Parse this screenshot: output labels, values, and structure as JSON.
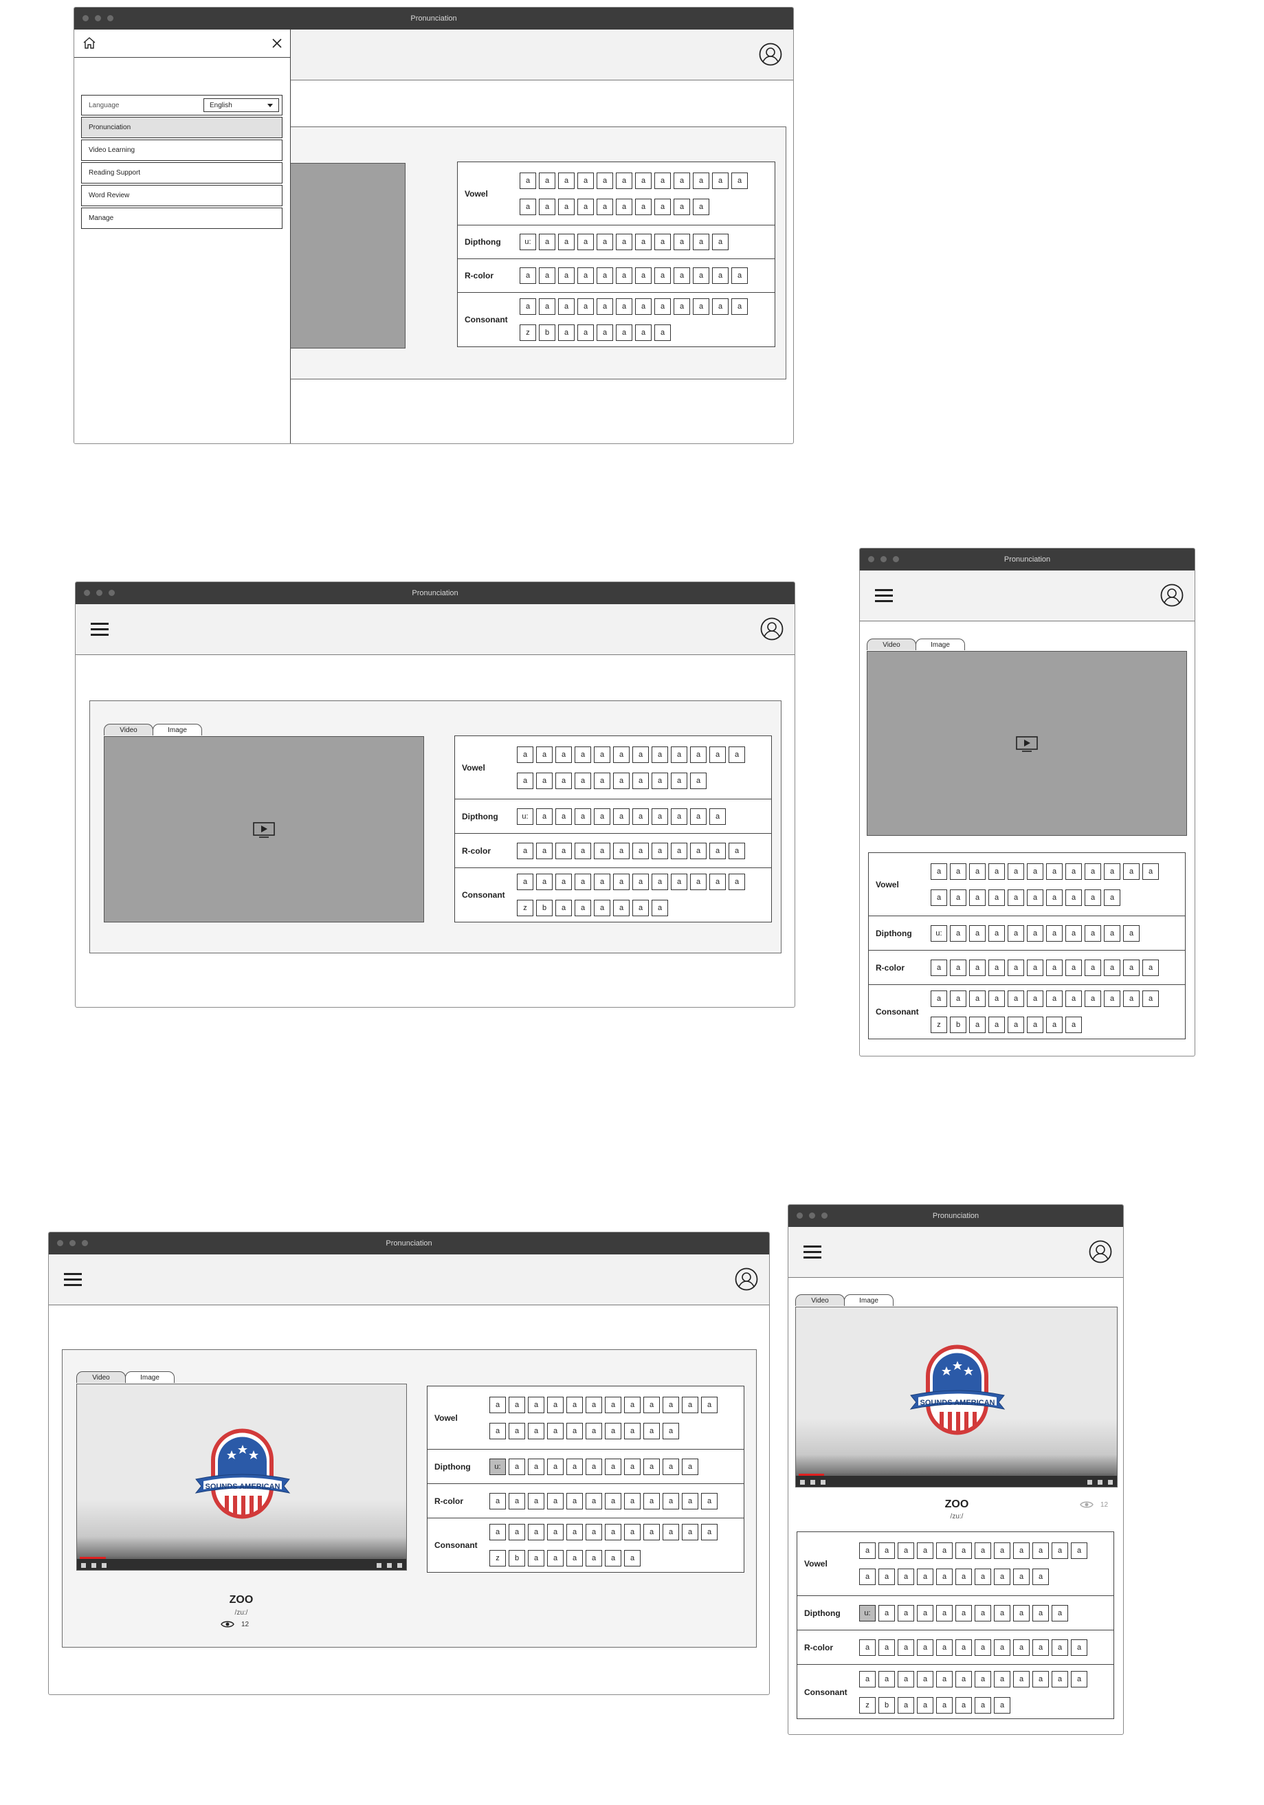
{
  "window_title": "Pronunciation",
  "tabs": [
    "Video",
    "Image"
  ],
  "drawer": {
    "language_label": "Language",
    "language_value": "English",
    "menu": [
      "Pronunciation",
      "Video Learning",
      "Reading Support",
      "Word Review",
      "Manage"
    ]
  },
  "sound_table": {
    "rows": [
      {
        "label": "Vowel",
        "lines": [
          [
            "a",
            "a",
            "a",
            "a",
            "a",
            "a",
            "a",
            "a",
            "a",
            "a",
            "a",
            "a"
          ],
          [
            "a",
            "a",
            "a",
            "a",
            "a",
            "a",
            "a",
            "a",
            "a",
            "a"
          ]
        ]
      },
      {
        "label": "Dipthong",
        "lines": [
          [
            "u:",
            "a",
            "a",
            "a",
            "a",
            "a",
            "a",
            "a",
            "a",
            "a",
            "a"
          ]
        ]
      },
      {
        "label": "R-color",
        "lines": [
          [
            "a",
            "a",
            "a",
            "a",
            "a",
            "a",
            "a",
            "a",
            "a",
            "a",
            "a",
            "a"
          ]
        ]
      },
      {
        "label": "Consonant",
        "lines": [
          [
            "a",
            "a",
            "a",
            "a",
            "a",
            "a",
            "a",
            "a",
            "a",
            "a",
            "a",
            "a"
          ],
          [
            "z",
            "b",
            "a",
            "a",
            "a",
            "a",
            "a",
            "a"
          ]
        ]
      }
    ]
  },
  "word_card": {
    "word": "ZOO",
    "ipa": "/zu:/",
    "views": "12",
    "badge_text": "SOUNDS AMERICAN"
  },
  "colors": {
    "titlebar": "#3c3c3c",
    "header": "#f2f2f2",
    "badge_blue": "#2b5aa8",
    "badge_red": "#d23a3a"
  }
}
